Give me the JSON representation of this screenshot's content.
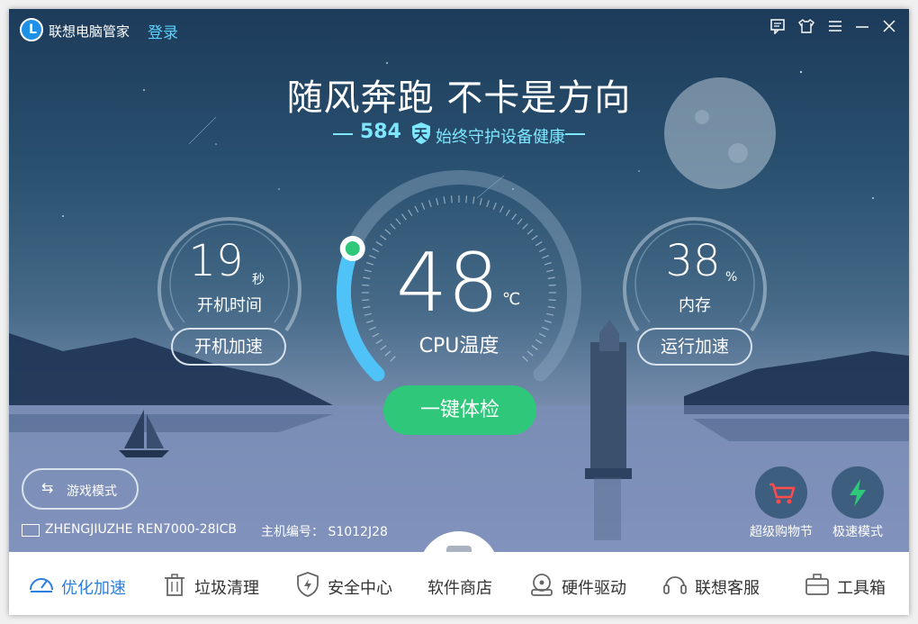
{
  "titlebar": {
    "app_name": "联想电脑管家",
    "login": "登录"
  },
  "hero": {
    "slogan": "随风奔跑 不卡是方向",
    "days": "584",
    "days_badge": "天",
    "days_text": "始终守护设备健康"
  },
  "boot": {
    "value": "19",
    "unit": "秒",
    "label": "开机时间",
    "button": "开机加速"
  },
  "cpu": {
    "value": "48",
    "unit": "℃",
    "label": "CPU温度",
    "fill_fraction": 0.25
  },
  "memory": {
    "value": "38",
    "unit": "%",
    "label": "内存",
    "button": "运行加速"
  },
  "check_button": "一键体检",
  "game_mode": "游戏模式",
  "device": {
    "name": "ZHENGJIUZHE REN7000-28ICB",
    "id_label": "主机编号：",
    "id_value": "S1012J28"
  },
  "quick": [
    {
      "label": "超级购物节",
      "icon": "shopping-cart-icon"
    },
    {
      "label": "极速模式",
      "icon": "lightning-icon"
    }
  ],
  "nav": [
    {
      "label": "优化加速",
      "icon": "speedometer-icon",
      "active": true
    },
    {
      "label": "垃圾清理",
      "icon": "trash-icon"
    },
    {
      "label": "安全中心",
      "icon": "shield-icon"
    },
    {
      "label": "软件商店",
      "icon": "shopping-bag-icon"
    },
    {
      "label": "硬件驱动",
      "icon": "hard-drive-icon"
    },
    {
      "label": "联想客服",
      "icon": "headset-icon"
    },
    {
      "label": "工具箱",
      "icon": "toolbox-icon"
    }
  ],
  "colors": {
    "accent": "#2a7fe0",
    "check": "#2fc77a",
    "gauge_fill": "#4fc3f7",
    "highlight": "#7ee6ff"
  }
}
